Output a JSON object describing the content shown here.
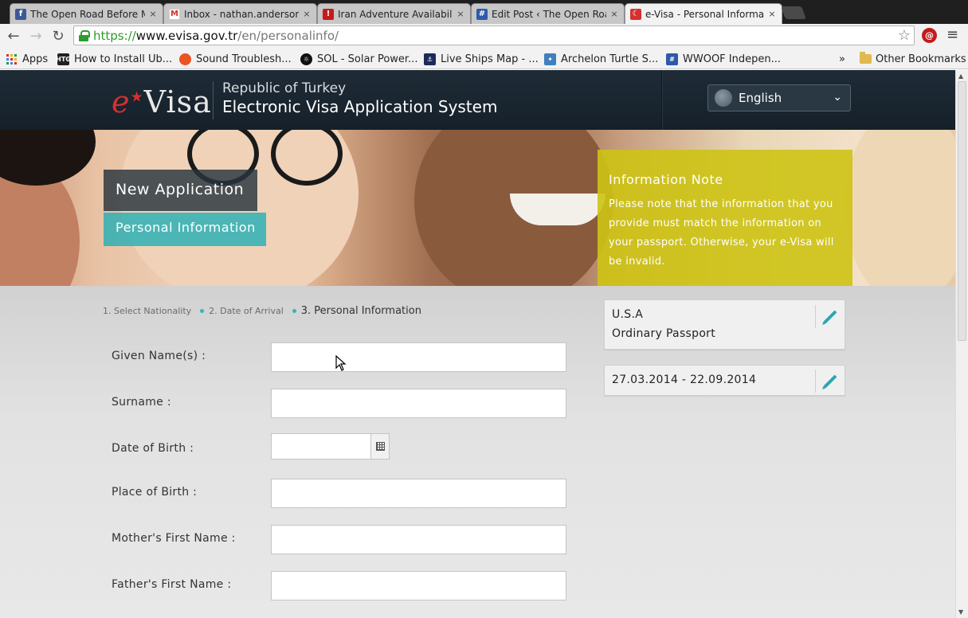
{
  "browser": {
    "tabs": [
      {
        "title": "The Open Road Before M",
        "favicon": "facebook-icon",
        "color": "#3b5998"
      },
      {
        "title": "Inbox - nathan.anderson8",
        "favicon": "gmail-icon",
        "color": "#d93025"
      },
      {
        "title": "Iran Adventure Availabilit",
        "favicon": "pdf-icon",
        "color": "#c41b1b"
      },
      {
        "title": "Edit Post ‹ The Open Roa",
        "favicon": "grid-icon",
        "color": "#2e5aa8"
      },
      {
        "title": "e-Visa - Personal Informat",
        "favicon": "evisa-icon",
        "color": "#d63030"
      }
    ],
    "close_glyph": "×",
    "url": {
      "scheme": "https://",
      "host": "www.evisa.gov.tr",
      "path": "/en/personalinfo/"
    },
    "bookmarks": [
      {
        "label": "Apps",
        "icon": "apps-grid-icon"
      },
      {
        "label": "How to Install Ub...",
        "icon": "htg-icon"
      },
      {
        "label": "Sound Troublesh...",
        "icon": "ubuntu-icon"
      },
      {
        "label": "SOL - Solar Power...",
        "icon": "sol-icon"
      },
      {
        "label": "Live Ships Map - ...",
        "icon": "ship-icon"
      },
      {
        "label": "Archelon Turtle S...",
        "icon": "turtle-icon"
      },
      {
        "label": "WWOOF Indepen...",
        "icon": "grid-icon"
      }
    ],
    "bookmarks_overflow": "»",
    "other_bookmarks": "Other Bookmarks",
    "ext_badge": "@"
  },
  "header": {
    "logo_e": "e",
    "logo_rest": "Visa",
    "subtitle": "Republic of Turkey",
    "title": "Electronic Visa Application System",
    "language": "English"
  },
  "hero": {
    "badge_main": "New Application",
    "badge_sub": "Personal Information",
    "note_title": "Information Note",
    "note_text": "Please note that the information that you provide must match the information on your passport. Otherwise, your e-Visa will be invalid."
  },
  "steps": {
    "step1": "1. Select Nationality",
    "step2": "2. Date of Arrival",
    "step3": "3. Personal Information"
  },
  "form": {
    "given_names": "Given Name(s) :",
    "surname": "Surname :",
    "date_of_birth": "Date of Birth :",
    "place_of_birth": "Place of Birth :",
    "mothers_first_name": "Mother's First Name :",
    "fathers_first_name": "Father's First Name :"
  },
  "summary": {
    "nationality": "U.S.A",
    "passport_type": "Ordinary Passport",
    "date_range": "27.03.2014 - 22.09.2014"
  },
  "colors": {
    "accent_teal": "#2aa7b0",
    "note_yellow": "#cdc314",
    "header_dark": "#1f2b36",
    "brand_red": "#d63030"
  }
}
